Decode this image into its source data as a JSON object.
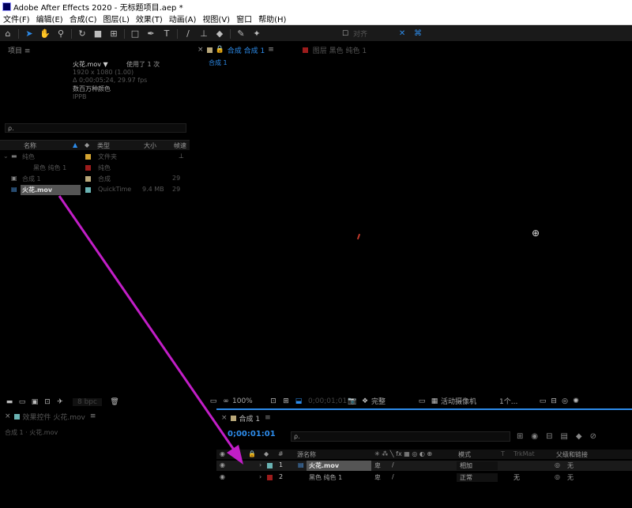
{
  "window": {
    "title": "Adobe After Effects 2020 - 无标题项目.aep *"
  },
  "menu": [
    "文件(F)",
    "编辑(E)",
    "合成(C)",
    "图层(L)",
    "效果(T)",
    "动画(A)",
    "视图(V)",
    "窗口",
    "帮助(H)"
  ],
  "toolbar": {
    "icons": [
      "home-icon",
      "selection-icon",
      "hand-icon",
      "zoom-icon",
      "rotate-icon",
      "camera-icon",
      "pan-behind-icon",
      "rectangle-icon",
      "pen-icon",
      "type-icon",
      "brush-icon",
      "clone-stamp-icon",
      "eraser-icon",
      "roto-brush-icon",
      "puppet-pin-icon"
    ],
    "snap_label": "对齐"
  },
  "project": {
    "tab": "项目 ≡",
    "selected_name": "火花.mov ▼",
    "used_count": "使用了 1 次",
    "info": [
      "1920 x 1080 (1.00)",
      "Δ 0;00;05;24, 29.97 fps",
      "数百万种颜色",
      "IPPB"
    ],
    "search_placeholder": "ρ.",
    "columns": [
      "名称",
      "类型",
      "大小",
      "帧速"
    ],
    "items": [
      {
        "name": "纯色",
        "type": "文件夹",
        "size": "",
        "fps": "",
        "color": "#d4a431"
      },
      {
        "name": "黑色 纯色 1",
        "type": "纯色",
        "size": "",
        "fps": "",
        "color": "#9c1c1c"
      },
      {
        "name": "合成 1",
        "type": "合成",
        "size": "",
        "fps": "29",
        "color": "#b9a87a"
      },
      {
        "name": "火花.mov",
        "type": "QuickTime",
        "size": "9.4 MB",
        "fps": "29",
        "color": "#6ab3b3"
      }
    ]
  },
  "viewer": {
    "comp_tab": "合成 合成 1",
    "comp_name": "合成 1",
    "layer_tab": "图层 黑色 纯色 1",
    "zoom": "100%",
    "timecode": "0;00;01;01",
    "quality": "完整",
    "camera": "活动摄像机",
    "views": "1个..."
  },
  "effects": {
    "tab": "效果控件 火花.mov",
    "breadcrumb": "合成 1 · 火花.mov",
    "bpc": "8 bpc"
  },
  "timeline": {
    "tab": "合成 1",
    "timecode": "0;00:01:01",
    "search_placeholder": "ρ.",
    "col_source": "源名称",
    "col_mode": "模式",
    "col_trkmat": "TrkMat",
    "col_parent": "父级和链接",
    "layers": [
      {
        "num": "1",
        "name": "火花.mov",
        "mode": "相加",
        "trkmat": "",
        "parent": "无",
        "color": "#6ab3b3"
      },
      {
        "num": "2",
        "name": "黑色 纯色 1",
        "mode": "正常",
        "trkmat": "无",
        "parent": "无",
        "color": "#9c1c1c"
      }
    ]
  },
  "colors": {
    "accent": "#2d8ceb",
    "arrow": "#c21ec7"
  }
}
